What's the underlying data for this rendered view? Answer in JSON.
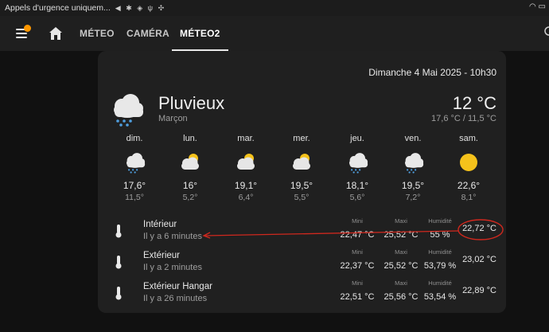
{
  "status_bar": {
    "notification_text": "Appels d'urgence uniquem...",
    "icons": [
      "nav-arrow",
      "bluetooth",
      "nfc",
      "usb",
      "location",
      "wifi",
      "battery"
    ]
  },
  "header": {
    "tabs": [
      {
        "label": "MÉTEO",
        "active": false
      },
      {
        "label": "CAMÉRA",
        "active": false
      },
      {
        "label": "MÉTEO2",
        "active": true
      }
    ],
    "accent_color": "#ff9800"
  },
  "weather": {
    "date": "Dimanche 4 Mai 2025 - 10h30",
    "condition": "Pluvieux",
    "location": "Marçon",
    "current_temp": "12 °C",
    "hi_lo": "17,6 °C / 11,5 °C",
    "current_icon": "rainy-cloud-icon",
    "forecast": [
      {
        "day": "dim.",
        "max": "17,6°",
        "min": "11,5°",
        "icon": "rainy-cloud"
      },
      {
        "day": "lun.",
        "max": "16°",
        "min": "5,2°",
        "icon": "partly-cloudy"
      },
      {
        "day": "mar.",
        "max": "19,1°",
        "min": "6,4°",
        "icon": "partly-cloudy"
      },
      {
        "day": "mer.",
        "max": "19,5°",
        "min": "5,5°",
        "icon": "partly-cloudy"
      },
      {
        "day": "jeu.",
        "max": "18,1°",
        "min": "5,6°",
        "icon": "rainy-cloud"
      },
      {
        "day": "ven.",
        "max": "19,5°",
        "min": "7,2°",
        "icon": "rainy-cloud"
      },
      {
        "day": "sam.",
        "max": "22,6°",
        "min": "8,1°",
        "icon": "sunny"
      }
    ]
  },
  "sensors": [
    {
      "name": "Intérieur",
      "updated": "Il y a 6 minutes",
      "mini_label": "Mini",
      "mini": "22,47 °C",
      "maxi_label": "Maxi",
      "maxi": "25,52 °C",
      "hum_label": "Humidité",
      "humidity": "55 %",
      "current": "22,72 °C"
    },
    {
      "name": "Extérieur",
      "updated": "Il y a 2 minutes",
      "mini_label": "Mini",
      "mini": "22,37 °C",
      "maxi_label": "Maxi",
      "maxi": "25,52 °C",
      "hum_label": "Humidité",
      "humidity": "53,79 %",
      "current": "23,02 °C"
    },
    {
      "name": "Extérieur Hangar",
      "updated": "Il y a 26 minutes",
      "mini_label": "Mini",
      "mini": "22,51 °C",
      "maxi_label": "Maxi",
      "maxi": "25,56 °C",
      "hum_label": "Humidité",
      "humidity": "53,54 %",
      "current": "22,89 °C"
    }
  ],
  "annotation_color": "#d0281e"
}
